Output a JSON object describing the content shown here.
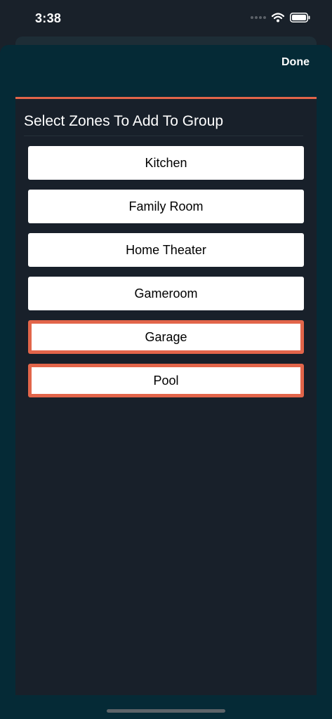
{
  "status_bar": {
    "time": "3:38",
    "icons": [
      "signal-dots-icon",
      "wifi-icon",
      "battery-icon"
    ]
  },
  "sheet": {
    "done_label": "Done",
    "title": "Select Zones To Add To Group",
    "zones": [
      {
        "label": "Kitchen",
        "selected": false
      },
      {
        "label": "Family Room",
        "selected": false
      },
      {
        "label": "Home Theater",
        "selected": false
      },
      {
        "label": "Gameroom",
        "selected": false
      },
      {
        "label": "Garage",
        "selected": true
      },
      {
        "label": "Pool",
        "selected": true
      }
    ]
  },
  "colors": {
    "accent": "#e2654a",
    "sheet_background": "#052a36",
    "panel_background": "#18202a",
    "page_background": "#19212a",
    "button_background": "#ffffff"
  }
}
